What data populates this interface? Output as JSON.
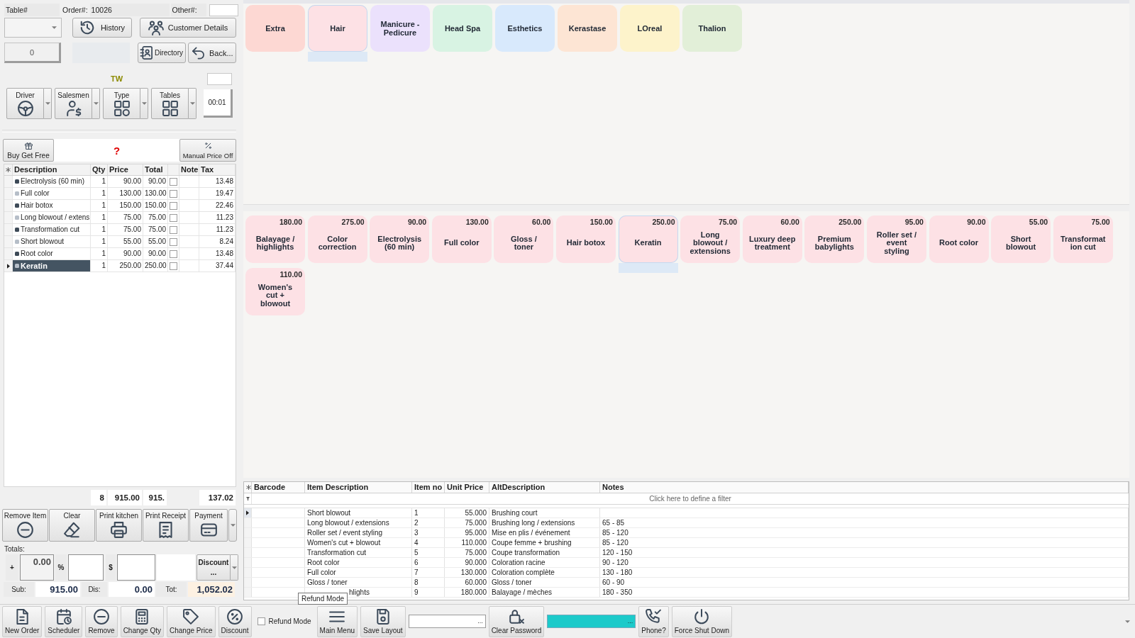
{
  "order_header": {
    "table_label": "Table#",
    "order_label": "Order#:",
    "order_number": "10026",
    "other_label": "Other#:"
  },
  "order_panel": {
    "count_value": "0",
    "history_button": "History",
    "customer_details_button": "Customer Details",
    "directory_button": "Directory",
    "back_button": "Back...",
    "station": "TW",
    "timer": "00:01"
  },
  "assign_buttons": [
    {
      "label": "Driver"
    },
    {
      "label": "Salesmen"
    },
    {
      "label": "Type"
    },
    {
      "label": "Tables"
    }
  ],
  "promo_bar": {
    "buy_get_free": "Buy Get Free",
    "message": "?",
    "manual_price_off": "Manual Price Off"
  },
  "order_grid": {
    "columns": [
      "Description",
      "Qty",
      "Price",
      "Total",
      "Note",
      "Tax"
    ],
    "rows": [
      {
        "description": "Electrolysis (60 min)",
        "qty": "1",
        "price": "90.00",
        "total": "90.00",
        "checked": false,
        "tax": "13.48",
        "color": "#3d4a57",
        "selected": false
      },
      {
        "description": "Full color",
        "qty": "1",
        "price": "130.00",
        "total": "130.00",
        "checked": false,
        "tax": "19.47",
        "color": "#b6bec8",
        "selected": false
      },
      {
        "description": "Hair botox",
        "qty": "1",
        "price": "150.00",
        "total": "150.00",
        "checked": false,
        "tax": "22.46",
        "color": "#3d4a57",
        "selected": false
      },
      {
        "description": "Long blowout / extens",
        "qty": "1",
        "price": "75.00",
        "total": "75.00",
        "checked": false,
        "tax": "11.23",
        "color": "#b6bec8",
        "selected": false
      },
      {
        "description": "Transformation cut",
        "qty": "1",
        "price": "75.00",
        "total": "75.00",
        "checked": false,
        "tax": "11.23",
        "color": "#3d4a57",
        "selected": false
      },
      {
        "description": "Short blowout",
        "qty": "1",
        "price": "55.00",
        "total": "55.00",
        "checked": false,
        "tax": "8.24",
        "color": "#b6bec8",
        "selected": false
      },
      {
        "description": "Root color",
        "qty": "1",
        "price": "90.00",
        "total": "90.00",
        "checked": false,
        "tax": "13.48",
        "color": "#3d4a57",
        "selected": false
      },
      {
        "description": "Keratin",
        "qty": "1",
        "price": "250.00",
        "total": "250.00",
        "checked": false,
        "tax": "37.44",
        "color": "#b6bec8",
        "selected": true
      }
    ],
    "footer": {
      "count": "8",
      "price_sum": "915.00",
      "total_sum": "915.",
      "tax_sum": "137.02"
    }
  },
  "action_buttons": [
    {
      "label": "Remove Item"
    },
    {
      "label": "Clear"
    },
    {
      "label": "Print kitchen"
    },
    {
      "label": "Print Receipt"
    },
    {
      "label": "Payment"
    }
  ],
  "totals": {
    "title": "Totals:",
    "plus": "+",
    "amount": "0.00",
    "percent": "%",
    "dollar": "$",
    "discount_button": "Discount",
    "discount_more": "...",
    "sub_label": "Sub:",
    "sub_value": "915.00",
    "dis_label": "Dis:",
    "dis_value": "0.00",
    "tot_label": "Tot:",
    "tot_value": "1,052.02"
  },
  "categories": [
    {
      "label": "Extra",
      "color": "#fdd8d3",
      "selected": false
    },
    {
      "label": "Hair",
      "color": "#fde1e5",
      "selected": true
    },
    {
      "label": "Manicure - Pedicure",
      "color": "#ebe1fc",
      "selected": false
    },
    {
      "label": "Head Spa",
      "color": "#d8f3e3",
      "selected": false
    },
    {
      "label": "Esthetics",
      "color": "#d8e9fc",
      "selected": false
    },
    {
      "label": "Kerastase",
      "color": "#fde5d4",
      "selected": false
    },
    {
      "label": "LOreal",
      "color": "#fdf3cb",
      "selected": false
    },
    {
      "label": "Thalion",
      "color": "#e2efd8",
      "selected": false
    }
  ],
  "items": [
    {
      "name": "Balayage / highlights",
      "price": "180.00",
      "selected": false
    },
    {
      "name": "Color correction",
      "price": "275.00",
      "selected": false
    },
    {
      "name": "Electrolysis (60 min)",
      "price": "90.00",
      "selected": false
    },
    {
      "name": "Full color",
      "price": "130.00",
      "selected": false
    },
    {
      "name": "Gloss / toner",
      "price": "60.00",
      "selected": false
    },
    {
      "name": "Hair botox",
      "price": "150.00",
      "selected": false
    },
    {
      "name": "Keratin",
      "price": "250.00",
      "selected": true
    },
    {
      "name": "Long blowout / extensions",
      "price": "75.00",
      "selected": false
    },
    {
      "name": "Luxury deep treatment",
      "price": "60.00",
      "selected": false
    },
    {
      "name": "Premium babylights",
      "price": "250.00",
      "selected": false
    },
    {
      "name": "Roller set / event styling",
      "price": "95.00",
      "selected": false
    },
    {
      "name": "Root color",
      "price": "90.00",
      "selected": false
    },
    {
      "name": "Short blowout",
      "price": "55.00",
      "selected": false
    },
    {
      "name": "Transformation cut",
      "price": "75.00",
      "selected": false
    },
    {
      "name": "Women's cut + blowout",
      "price": "110.00",
      "selected": false
    }
  ],
  "product_table": {
    "columns": [
      "Barcode",
      "Item Description",
      "Item no",
      "Unit Price",
      "AltDescription",
      "Notes"
    ],
    "filter_hint": "Click here to define a filter",
    "rows": [
      {
        "item_description": "Short blowout",
        "item_no": "1",
        "unit_price": "55.000",
        "alt_description": "Brushing court",
        "selected": true
      },
      {
        "item_description": "Long blowout / extensions",
        "item_no": "2",
        "unit_price": "75.000",
        "alt_description": "Brushing long / extensions",
        "notes": "65 - 85",
        "selected": false
      },
      {
        "item_description": "Roller set / event styling",
        "item_no": "3",
        "unit_price": "95.000",
        "alt_description": "Mise en plis / événement",
        "notes": "85 - 120",
        "selected": false
      },
      {
        "item_description": "Women's cut + blowout",
        "item_no": "4",
        "unit_price": "110.000",
        "alt_description": "Coupe femme + brushing",
        "notes": "85 - 120",
        "selected": false
      },
      {
        "item_description": "Transformation cut",
        "item_no": "5",
        "unit_price": "75.000",
        "alt_description": "Coupe transformation",
        "notes": "120 - 150",
        "selected": false
      },
      {
        "item_description": "Root color",
        "item_no": "6",
        "unit_price": "90.000",
        "alt_description": "Coloration racine",
        "notes": "90 - 120",
        "selected": false
      },
      {
        "item_description": "Full color",
        "item_no": "7",
        "unit_price": "130.000",
        "alt_description": "Coloration complète",
        "notes": "130 - 180",
        "selected": false
      },
      {
        "item_description": "Gloss / toner",
        "item_no": "8",
        "unit_price": "60.000",
        "alt_description": "Gloss / toner",
        "notes": "60 - 90",
        "selected": false
      },
      {
        "item_description": "hlights",
        "item_no": "9",
        "unit_price": "180.000",
        "alt_description": "Balayage / mèches",
        "notes": "180 - 350",
        "selected": false
      }
    ]
  },
  "tooltip": {
    "text": "Refund Mode"
  },
  "toolbar": [
    {
      "kind": "button",
      "label": "New Order"
    },
    {
      "kind": "button",
      "label": "Scheduler"
    },
    {
      "kind": "button",
      "label": "Remove"
    },
    {
      "kind": "button",
      "label": "Change Qty"
    },
    {
      "kind": "button",
      "label": "Change Price"
    },
    {
      "kind": "button",
      "label": "Discount"
    },
    {
      "kind": "checkbox",
      "label": "Refund Mode",
      "checked": false
    },
    {
      "kind": "button",
      "label": "Main Menu"
    },
    {
      "kind": "button",
      "label": "Save Layout"
    },
    {
      "kind": "field",
      "more": "...",
      "color": "#ffffff"
    },
    {
      "kind": "button",
      "label": "Clear Password"
    },
    {
      "kind": "field",
      "more": "...",
      "color": "#1ccaca"
    },
    {
      "kind": "button",
      "label": "Phone?"
    },
    {
      "kind": "button",
      "label": "Force Shut Down"
    }
  ]
}
